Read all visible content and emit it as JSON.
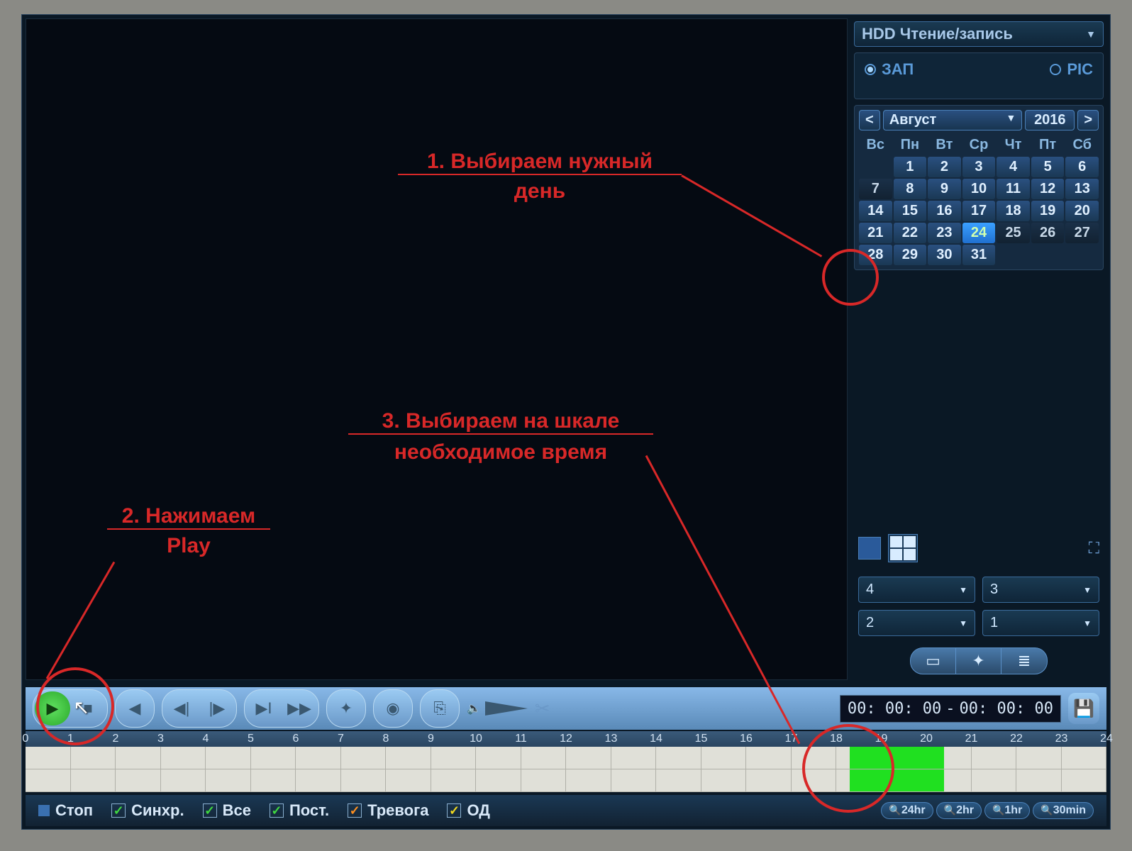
{
  "hdd": {
    "label": "HDD Чтение/запись"
  },
  "mode": {
    "rec": "ЗАП",
    "pic": "PIC"
  },
  "calendar": {
    "prev": "<",
    "next": ">",
    "month": "Август",
    "year": "2016",
    "dow": [
      "Вс",
      "Пн",
      "Вт",
      "Ср",
      "Чт",
      "Пт",
      "Сб"
    ],
    "weeks": [
      [
        "",
        "1",
        "2",
        "3",
        "4",
        "5",
        "6"
      ],
      [
        "7",
        "8",
        "9",
        "10",
        "11",
        "12",
        "13"
      ],
      [
        "14",
        "15",
        "16",
        "17",
        "18",
        "19",
        "20"
      ],
      [
        "21",
        "22",
        "23",
        "24",
        "25",
        "26",
        "27"
      ],
      [
        "28",
        "29",
        "30",
        "31",
        "",
        "",
        ""
      ]
    ],
    "selected": "24",
    "highlight": [
      "22",
      "23"
    ]
  },
  "channels": {
    "a": "4",
    "b": "3",
    "c": "2",
    "d": "1"
  },
  "time": {
    "start": "00: 00: 00",
    "sep": "-",
    "end": "00: 00: 00"
  },
  "ruler_ticks": [
    0,
    1,
    2,
    3,
    4,
    5,
    6,
    7,
    8,
    9,
    10,
    11,
    12,
    13,
    14,
    15,
    16,
    17,
    18,
    19,
    20,
    21,
    22,
    23,
    24
  ],
  "recording": {
    "start_h": 18.3,
    "end_h": 20.4
  },
  "footer": {
    "stop": "Стоп",
    "sync": "Синхр.",
    "all": "Все",
    "const": "Пост.",
    "alarm": "Тревога",
    "md": "ОД"
  },
  "zoom": {
    "z24": "24hr",
    "z2": "2hr",
    "z1": "1hr",
    "z30": "30min"
  },
  "anno": {
    "a1_l1": "1.  Выбираем нужный",
    "a1_l2": "день",
    "a2_l1": "2. Нажимаем",
    "a2_l2": "Play",
    "a3_l1": "3. Выбираем на шкале",
    "a3_l2": "необходимое время"
  }
}
